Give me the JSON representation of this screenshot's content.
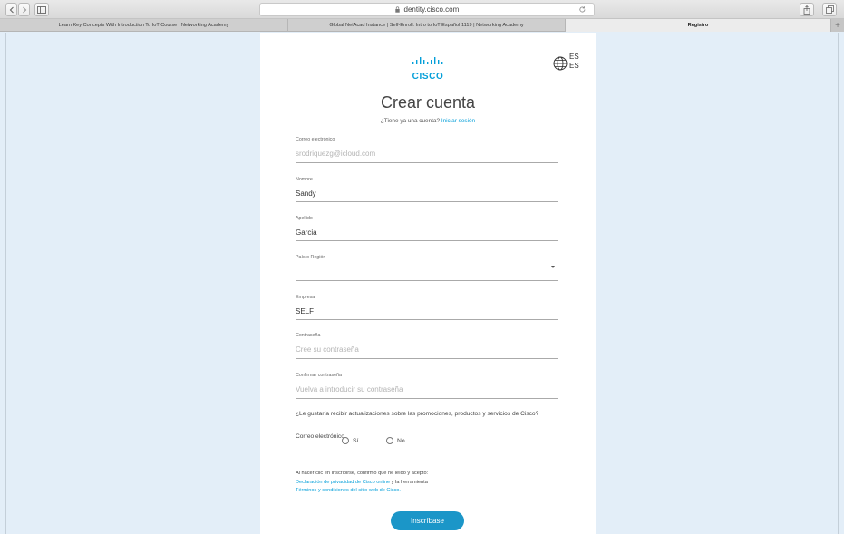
{
  "browser": {
    "url": "identity.cisco.com",
    "tabs": [
      {
        "label": "Learn Key Concepts With Introduction To IoT Course | Networking Academy",
        "active": false
      },
      {
        "label": "Global NetAcad Instance | Self-Enroll: Intro to IoT Español 1119 | Networking Academy",
        "active": false
      },
      {
        "label": "Registro",
        "active": true
      }
    ],
    "new_tab": "+"
  },
  "logo": {
    "word": "CISCO",
    "color": "#049fd9"
  },
  "language": {
    "icon": "globe-icon",
    "code_top": "ES",
    "code_bottom": "ES"
  },
  "form": {
    "title": "Crear cuenta",
    "have_account": "¿Tiene ya una cuenta?",
    "signin_link": "Iniciar sesión",
    "fields": {
      "email": {
        "label": "Correo electrónico",
        "placeholder": "srodriquezg@icloud.com"
      },
      "first_name": {
        "label": "Nombre",
        "value": "Sandy"
      },
      "last_name": {
        "label": "Apellido",
        "value": "Garcia"
      },
      "country": {
        "label": "País o Región",
        "value": ""
      },
      "company": {
        "label": "Empresa",
        "value": "SELF"
      },
      "password": {
        "label": "Contraseña",
        "placeholder": "Cree su contraseña"
      },
      "confirm_password": {
        "label": "Confirmar contraseña",
        "placeholder": "Vuelva a introducir su contraseña"
      }
    },
    "updates_question": "¿Le gustaría recibir actualizaciones sobre las promociones, productos y servicios de Cisco?",
    "email_option_label": "Correo electrónico",
    "radio_yes": "Sí",
    "radio_no": "No",
    "consent": {
      "intro": "Al hacer clic en Inscribirse, confirmo que he leído y acepto:",
      "privacy_link": "Declaración de privacidad de Cisco online",
      "connector": "y la herramienta",
      "terms_link": "Términos y condiciones del sitio web de Cisco."
    },
    "submit_label": "Inscríbase"
  },
  "colors": {
    "accent": "#049fd9",
    "button": "#1b96c8",
    "page_bg": "#e3eef8"
  }
}
